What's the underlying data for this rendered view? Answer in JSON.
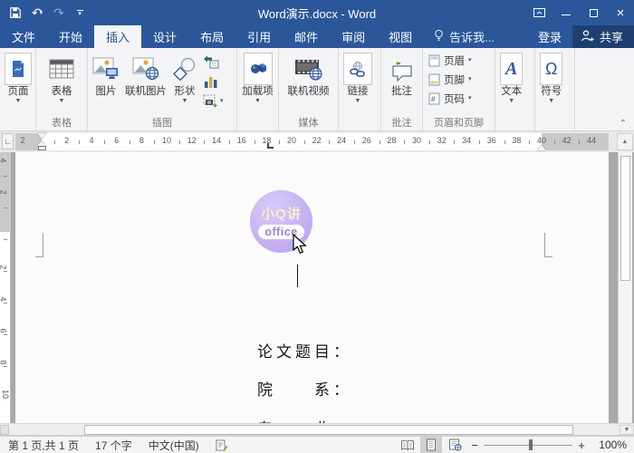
{
  "colors": {
    "titlebar_blue": "#2b579a",
    "share_button_bg": "#1e3f6f",
    "ribbon_bg": "#f3f4f6",
    "accent_blue": "#2b579a",
    "logo_purple": "#c5b2f2",
    "logo_title_color": "#faf3cf",
    "logo_pill_text": "#9a7ce0",
    "page_bg": "#fbfbfb",
    "doc_area_bg": "#a9a9a9"
  },
  "title_bar": {
    "title": "Word演示.docx - Word"
  },
  "tabs": [
    {
      "id": "file",
      "label": "文件",
      "active": false
    },
    {
      "id": "home",
      "label": "开始",
      "active": false
    },
    {
      "id": "insert",
      "label": "插入",
      "active": true
    },
    {
      "id": "design",
      "label": "设计",
      "active": false
    },
    {
      "id": "layout",
      "label": "布局",
      "active": false
    },
    {
      "id": "references",
      "label": "引用",
      "active": false
    },
    {
      "id": "mailings",
      "label": "邮件",
      "active": false
    },
    {
      "id": "review",
      "label": "审阅",
      "active": false
    },
    {
      "id": "view",
      "label": "视图",
      "active": false
    }
  ],
  "tell_me": "告诉我...",
  "sign_in": "登录",
  "share": "共享",
  "ribbon": {
    "pages": {
      "label": "页面"
    },
    "tables": {
      "button": "表格",
      "group": "表格"
    },
    "illustrations": {
      "picture": "图片",
      "online_pictures": "联机图片",
      "shapes": "形状",
      "small_icons": [
        "smartart-icon",
        "chart-icon",
        "screenshot-icon"
      ],
      "group": "插图"
    },
    "addins": {
      "label": "加载项"
    },
    "media": {
      "online_video": "联机视频",
      "group": "媒体"
    },
    "links": {
      "label": "链接"
    },
    "comments": {
      "label": "批注",
      "group": "批注"
    },
    "header_footer": {
      "header": "页眉",
      "footer": "页脚",
      "page_number": "页码",
      "group": "页眉和页脚"
    },
    "text": {
      "label": "文本"
    },
    "symbols": {
      "label": "符号"
    }
  },
  "ruler": {
    "left_margin_number": "2",
    "numbers": [
      2,
      4,
      6,
      8,
      10,
      12,
      14,
      16,
      18,
      20,
      22,
      24,
      26,
      28,
      30,
      32,
      34,
      36,
      38
    ],
    "right_margin_numbers": [
      40,
      42,
      44
    ]
  },
  "vruler": {
    "margin_numbers": [
      4,
      2
    ],
    "text_numbers": [
      2,
      4,
      6,
      8,
      10
    ]
  },
  "document": {
    "logo": {
      "title": "小Q讲",
      "subtitle": "office"
    },
    "line1": "论文题目：",
    "line2": "院　　系：",
    "line3_partial": "专　　业："
  },
  "status_bar": {
    "page_info": "第 1 页,共 1 页",
    "word_count": "17 个字",
    "language": "中文(中国)",
    "zoom_level": "100%"
  }
}
